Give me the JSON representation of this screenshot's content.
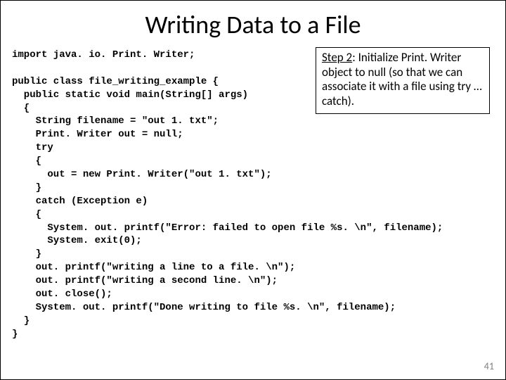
{
  "title": "Writing Data to a File",
  "callout": "Step 2: Initialize Print. Writer object to null (so that we can associate it with a file using try … catch).",
  "code": "import java. io. Print. Writer;\n\npublic class file_writing_example {\n  public static void main(String[] args)\n  {\n    String filename = \"out 1. txt\";\n    Print. Writer out = null;\n    try\n    {\n      out = new Print. Writer(\"out 1. txt\");\n    }\n    catch (Exception e)\n    {\n      System. out. printf(\"Error: failed to open file %s. \\n\", filename);\n      System. exit(0);\n    }\n    out. printf(\"writing a line to a file. \\n\");\n    out. printf(\"writing a second line. \\n\");\n    out. close();\n    System. out. printf(\"Done writing to file %s. \\n\", filename);\n  }\n}",
  "slide_number": "41"
}
